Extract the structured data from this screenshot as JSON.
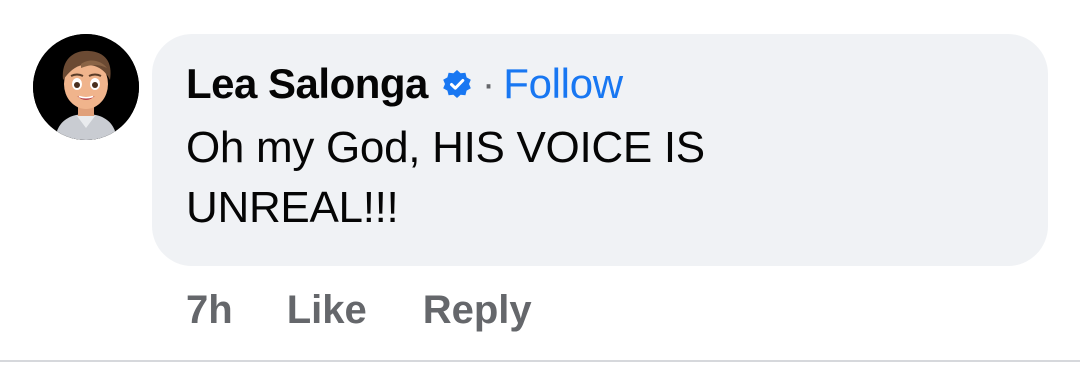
{
  "comment": {
    "author": "Lea Salonga",
    "verified_icon": "verified-badge-icon",
    "separator": "·",
    "follow_label": "Follow",
    "text": "Oh my God, HIS VOICE IS UNREAL!!!",
    "time": "7h",
    "like_label": "Like",
    "reply_label": "Reply",
    "avatar_icon": "cartoon-avatar-icon"
  },
  "colors": {
    "bubble": "#f0f2f5",
    "link": "#1877f2",
    "muted": "#65676b",
    "text": "#050505"
  }
}
